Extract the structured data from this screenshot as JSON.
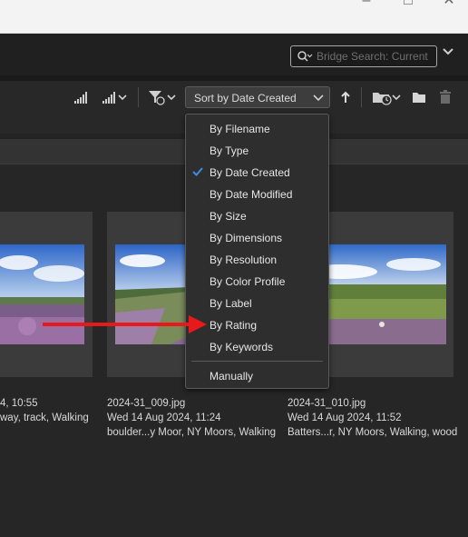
{
  "search": {
    "placeholder": "Bridge Search: Current"
  },
  "toolbar": {
    "sort_label": "Sort by Date Created"
  },
  "sort_menu": {
    "items": [
      "By Filename",
      "By Type",
      "By Date Created",
      "By Date Modified",
      "By Size",
      "By Dimensions",
      "By Resolution",
      "By Color Profile",
      "By Label",
      "By Rating",
      "By Keywords"
    ],
    "checked": "By Date Created",
    "manual": "Manually"
  },
  "thumbnails": [
    {
      "name": "",
      "date": "4, 10:55",
      "keywords": "way, track, Walking"
    },
    {
      "name": "2024-31_009.jpg",
      "date": "Wed 14 Aug 2024, 11:24",
      "keywords": "boulder...y Moor, NY Moors, Walking"
    },
    {
      "name": "2024-31_010.jpg",
      "date": "Wed 14 Aug 2024, 11:52",
      "keywords": "Batters...r, NY Moors, Walking, wood"
    }
  ],
  "colors": {
    "accent_check": "#3a8ee6",
    "arrow": "#e8191a"
  }
}
